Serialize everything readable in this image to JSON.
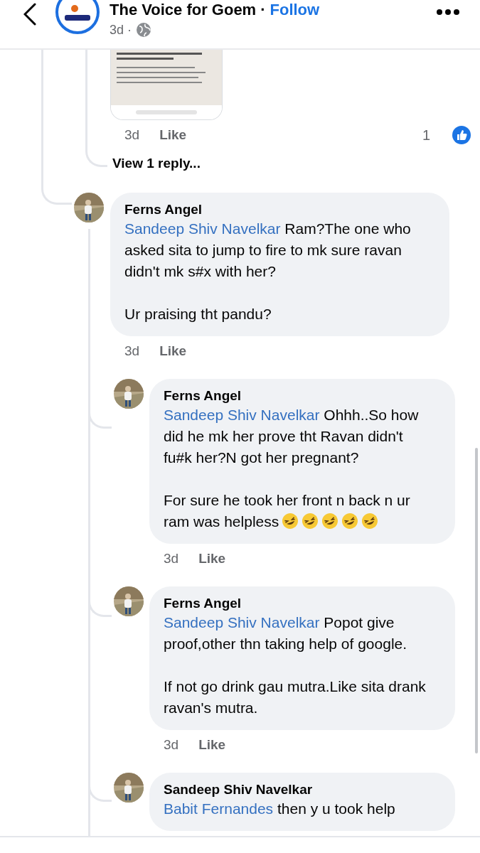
{
  "header": {
    "title": "The Voice for Goem",
    "separator": "·",
    "follow": "Follow",
    "time": "3d ·"
  },
  "top_actions": {
    "time": "3d",
    "like": "Like",
    "like_count": "1"
  },
  "view_replies": "View 1 reply...",
  "comments": [
    {
      "nested": false,
      "author": "Ferns Angel",
      "mention": "Sandeep Shiv Navelkar",
      "paragraphs": [
        "Ram?The one who asked sita to jump to fire to mk sure ravan didn't mk s#x with her?",
        "Ur praising tht pandu?"
      ],
      "time": "3d",
      "like": "Like"
    },
    {
      "nested": true,
      "author": "Ferns Angel",
      "mention": "Sandeep Shiv Navelkar",
      "paragraphs": [
        "Ohhh..So how did he mk her prove tht Ravan didn't fu#k her?N got her pregnant?",
        "For sure he took her front n back n ur ram was helpless"
      ],
      "emojis": [
        {
          "kind": "rofl"
        },
        {
          "kind": "rofl"
        },
        {
          "kind": "rofl"
        },
        {
          "kind": "rofl"
        },
        {
          "kind": "rofl"
        }
      ],
      "time": "3d",
      "like": "Like"
    },
    {
      "nested": true,
      "author": "Ferns Angel",
      "mention": "Sandeep Shiv Navelkar",
      "paragraphs": [
        "Popot give proof,other thn taking help of google.",
        "If not go drink gau mutra.Like sita drank ravan's mutra."
      ],
      "time": "3d",
      "like": "Like"
    },
    {
      "nested": true,
      "author": "Sandeep Shiv Navelkar",
      "mention": "Babit Fernandes",
      "paragraphs": [
        "then y u took help"
      ]
    }
  ]
}
